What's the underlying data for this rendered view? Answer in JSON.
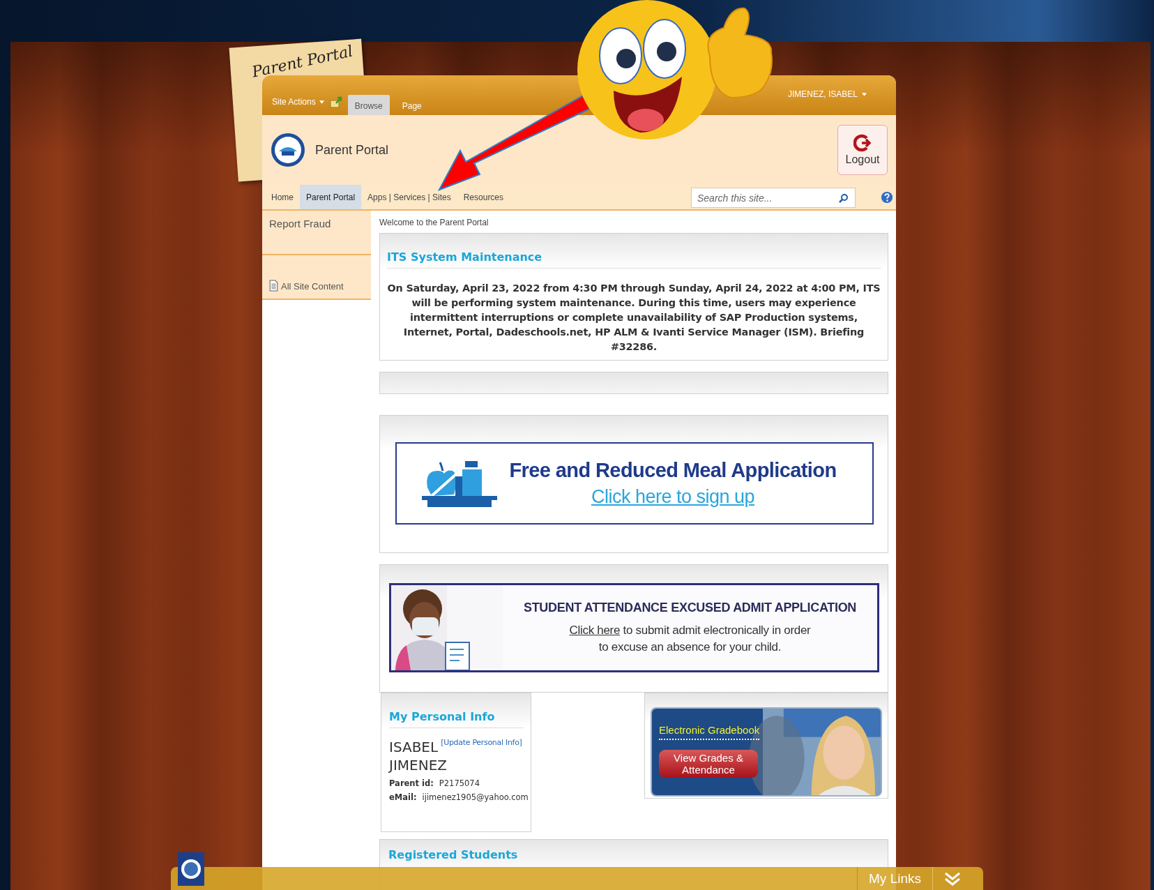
{
  "sticky_note": {
    "text": "Parent Portal"
  },
  "ribbon": {
    "site_actions": "Site Actions",
    "tabs": [
      {
        "label": "Browse",
        "selected": true
      },
      {
        "label": "Page",
        "selected": false
      }
    ],
    "user": "JIMENEZ, ISABEL"
  },
  "header": {
    "site_title": "Parent Portal",
    "logout": "Logout"
  },
  "nav": {
    "items": [
      {
        "label": "Home",
        "selected": false
      },
      {
        "label": "Parent Portal",
        "selected": true
      },
      {
        "label": "Apps | Services | Sites",
        "selected": false
      },
      {
        "label": "Resources",
        "selected": false
      }
    ],
    "search": {
      "placeholder": "Search this site..."
    }
  },
  "sidebar": {
    "items": [
      {
        "label": "Report Fraud",
        "kind": "link"
      },
      {
        "label": "All Site Content",
        "kind": "icon-link"
      }
    ]
  },
  "breadcrumb": "Welcome to the Parent Portal",
  "maintenance": {
    "title": "ITS System Maintenance",
    "body": "On Saturday, April 23, 2022 from 4:30 PM through Sunday, April 24, 2022 at 4:00 PM, ITS will be performing system maintenance. During this time, users may experience intermittent interruptions or complete unavailability of SAP Production systems, Internet, Portal, Dadeschools.net, HP ALM & Ivanti Service Manager (ISM).  Briefing #32286."
  },
  "meal_banner": {
    "title": "Free and Reduced Meal Application",
    "link": "Click here to sign up"
  },
  "attendance_banner": {
    "title": "STUDENT ATTENDANCE EXCUSED ADMIT APPLICATION",
    "link": "Click here",
    "text": " to submit admit electronically in order to excuse an absence for your child."
  },
  "personal_info": {
    "title": "My Personal Info",
    "first_name": "ISABEL",
    "last_name": "JIMENEZ",
    "update_link": "[Update Personal Info]",
    "fields": [
      {
        "label": "Parent id:",
        "value": "P2175074"
      },
      {
        "label": "eMail:",
        "value": "ijimenez1905@yahoo.com"
      }
    ]
  },
  "gradebook": {
    "title": "Electronic Gradebook",
    "button": "View Grades & Attendance"
  },
  "registered_students": {
    "title": "Registered Students"
  },
  "bottom_bar": {
    "label": "My Links"
  }
}
